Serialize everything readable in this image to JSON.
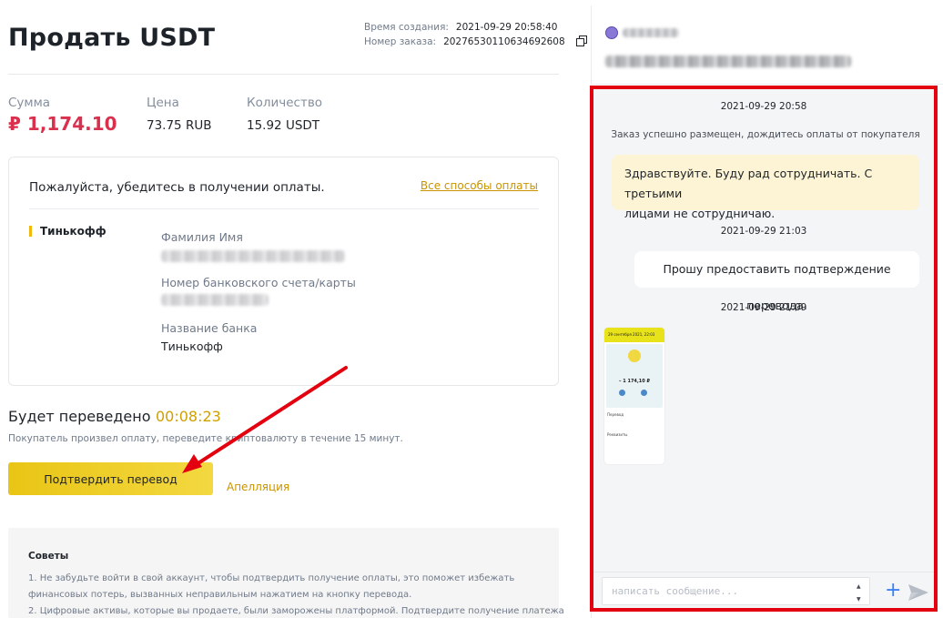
{
  "order": {
    "title": "Продать USDT",
    "created_label": "Время создания:",
    "created_value": "2021-09-29 20:58:40",
    "number_label": "Номер заказа:",
    "number_value": "20276530110634692608"
  },
  "summary": {
    "amount_label": "Сумма",
    "amount_value": "₽ 1,174.10",
    "price_label": "Цена",
    "price_value": "73.75 RUB",
    "qty_label": "Количество",
    "qty_value": "15.92 USDT"
  },
  "payment": {
    "heading": "Пожалуйста, убедитесь в получении оплаты.",
    "all_methods_link": "Все способы оплаты",
    "method_name": "Тинькофф",
    "name_label": "Фамилия Имя",
    "account_label": "Номер банковского счета/карты",
    "bank_label": "Название банка",
    "bank_value": "Тинькофф"
  },
  "timer": {
    "label": "Будет переведено",
    "value": "00:08:23",
    "hint": "Покупатель произвел оплату, переведите криптовалюту в течение 15 минут."
  },
  "actions": {
    "confirm_label": "Подтвердить перевод",
    "appeal_label": "Апелляция"
  },
  "tips": {
    "heading": "Советы",
    "lines": [
      "1. Не забудьте войти в свой аккаунт, чтобы подтвердить получение оплаты, это поможет избежать",
      "финансовых потерь, вызванных неправильным нажатием на кнопку перевода.",
      "2. Цифровые активы, которые вы продаете, были заморожены платформой. Подтвердите получение платежа"
    ]
  },
  "chat": {
    "messages": [
      {
        "type": "timestamp",
        "text": "2021-09-29 20:58"
      },
      {
        "type": "system",
        "text": "Заказ успешно размещен, дождитесь оплаты от покупателя"
      },
      {
        "type": "bubble",
        "text_line1": "Здравствуйте. Буду рад сотрудничать. С третьими",
        "text_line2": "лицами не сотрудничаю."
      },
      {
        "type": "timestamp",
        "text": "2021-09-29 21:03"
      },
      {
        "type": "bubble",
        "text": "Прошу предоставить подтверждение перевода."
      },
      {
        "type": "timestamp",
        "text": "2021-09-29 21:09"
      }
    ],
    "input_placeholder": "написать сообщение...",
    "attachment": {
      "bar_text": "29 сентября 2021, 22:03",
      "amount": "– 1 174,10 ₽",
      "label1": "Перевод",
      "label2": "Реквизиты"
    }
  },
  "colors": {
    "accent": "#f0b90b",
    "amount_red": "#d9304e",
    "timer_yellow": "#d0a000",
    "highlight_frame": "#e3000f",
    "arrow": "#e3000f",
    "plus_blue": "#3b82f6"
  }
}
